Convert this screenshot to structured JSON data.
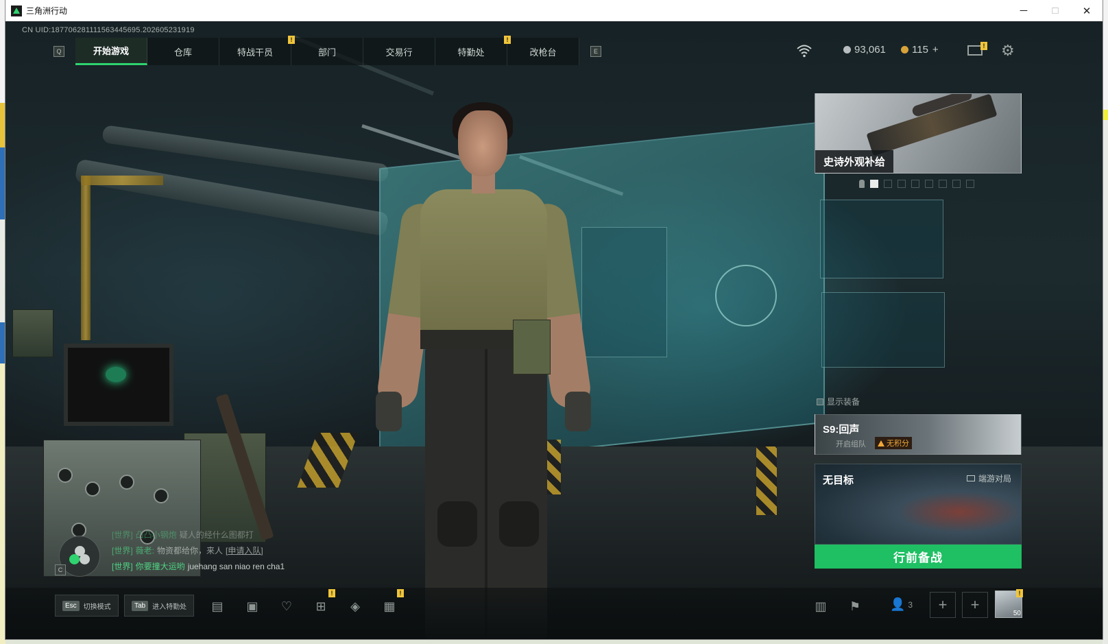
{
  "window": {
    "title": "三角洲行动",
    "controls": {
      "minimize": "─",
      "maximize": "□",
      "close": "✕"
    }
  },
  "uid": "CN UID:187706281111563445695.202605231919",
  "nav": {
    "left_key": "Q",
    "right_key": "E",
    "tabs": [
      {
        "label": "开始游戏",
        "active": true
      },
      {
        "label": "仓库"
      },
      {
        "label": "特战干员"
      },
      {
        "label": "部门"
      },
      {
        "label": "交易行"
      },
      {
        "label": "特勤处"
      },
      {
        "label": "改枪台"
      }
    ]
  },
  "status": {
    "silver_amount": "93,061",
    "gold_amount": "115",
    "gold_add": "+",
    "badge": "!"
  },
  "cards": {
    "epic_supply": {
      "title": "史诗外观补给",
      "dots_total": 8,
      "dots_active_index": 0
    },
    "show_gear_label": "显示装备",
    "season": {
      "title": "S9:回声",
      "subtitle": "开启组队",
      "tag": "无积分"
    },
    "map": {
      "title": "无目标",
      "mode": "端游对局"
    },
    "go_button": "行前备战"
  },
  "chat": {
    "key": "C",
    "lines": [
      {
        "tag": "[世界]",
        "name": "凸凸小钢炮",
        "msg": "疑人的经什么图都打",
        "style": "faded"
      },
      {
        "tag": "[世界]",
        "name": "薇老:",
        "msg": "物资都给你，来人",
        "link": "[申请入队]",
        "style": "mid"
      },
      {
        "tag": "[世界]",
        "name": "你要撞大运哟",
        "msg": "juehang san niao ren cha1",
        "style": ""
      }
    ]
  },
  "bottom": {
    "hints": [
      {
        "key": "Esc",
        "label": "切换模式"
      },
      {
        "key": "Tab",
        "label": "进入特勤处"
      }
    ],
    "friends_count": "3",
    "level": "50",
    "plus": "+"
  },
  "colors": {
    "accent_green": "#2fd36f",
    "go_button_green": "#1fbf63",
    "badge_yellow": "#f0c53a",
    "chat_green": "#4fd383",
    "warning_orange": "#f0a83a"
  }
}
